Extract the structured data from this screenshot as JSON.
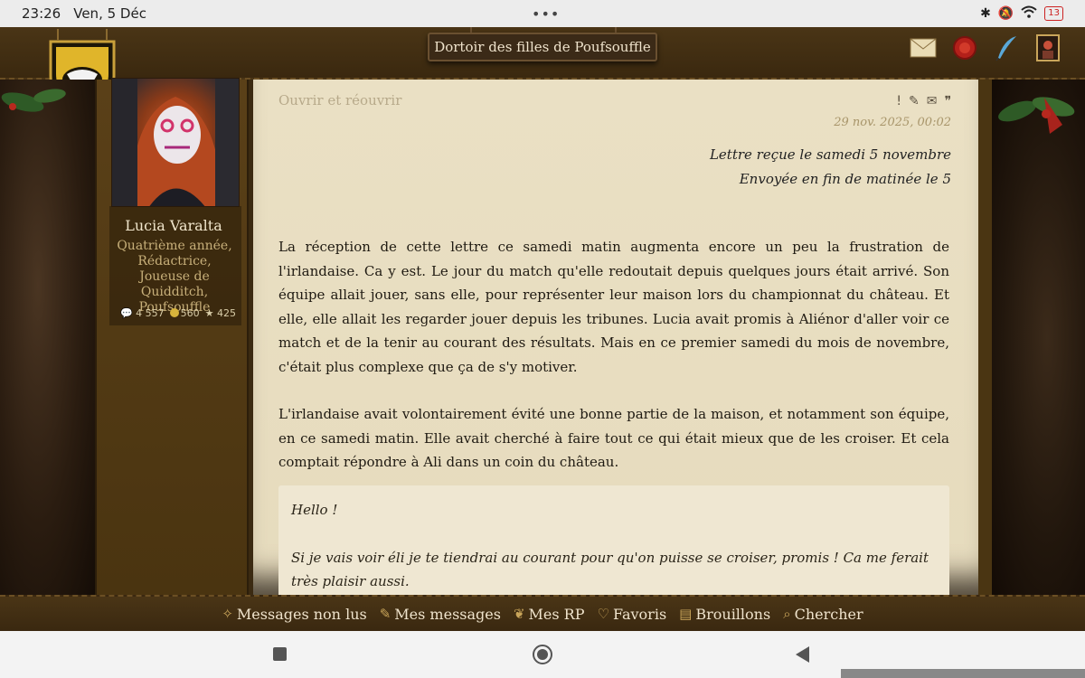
{
  "status_bar": {
    "time": "23:26",
    "date": "Ven, 5 Déc",
    "dots": "•••",
    "battery": "13"
  },
  "header": {
    "location": "Dortoir des filles de Poufsouffle",
    "icons": [
      "envelope-icon",
      "seal-icon",
      "quill-icon",
      "portrait-icon"
    ]
  },
  "profile": {
    "name": "Lucia Varalta",
    "role": "Quatrième année, Rédactrice, Joueuse de Quidditch, Poufsouffle",
    "messages": "4 557",
    "coins": "560",
    "stars": "425"
  },
  "post": {
    "title": "Ouvrir et réouvrir",
    "date": "29 nov. 2025, 00:02",
    "header_line1": "Lettre reçue le samedi 5 novembre",
    "header_line2": "Envoyée en fin de matinée le 5",
    "paragraphs": [
      "La réception de cette lettre ce samedi matin augmenta encore un peu la frustration de l'irlandaise. Ca y est. Le jour du match qu'elle redoutait depuis quelques jours était arrivé. Son équipe allait jouer, sans elle, pour représenter leur maison lors du championnat du château. Et elle, elle allait les regarder jouer depuis les tribunes. Lucia avait promis à Aliénor d'aller voir ce match et de la tenir au courant des résultats. Mais en ce premier samedi du mois de novembre, c'était plus complexe que ça de s'y motiver.",
      "L'irlandaise avait volontairement évité une bonne partie de la maison, et notamment son équipe, en ce samedi matin. Elle avait cherché à faire tout ce qui était mieux que de les croiser. Et cela comptait répondre à Ali dans un coin du château."
    ],
    "quote": [
      "Hello !",
      "Si je vais voir éli je te tiendrai au courant pour qu'on puisse se croiser, promis ! Ca me ferait très plaisir aussi."
    ]
  },
  "bottom_nav": [
    {
      "label": "Messages non lus",
      "icon": "sparkle-icon"
    },
    {
      "label": "Mes messages",
      "icon": "pencil-icon"
    },
    {
      "label": "Mes RP",
      "icon": "feather-icon"
    },
    {
      "label": "Favoris",
      "icon": "heart-icon"
    },
    {
      "label": "Brouillons",
      "icon": "scroll-icon"
    },
    {
      "label": "Chercher",
      "icon": "search-icon"
    }
  ],
  "colors": {
    "parchment": "#e8ddc0",
    "wood": "#4a3516",
    "gold": "#c9a55a"
  }
}
